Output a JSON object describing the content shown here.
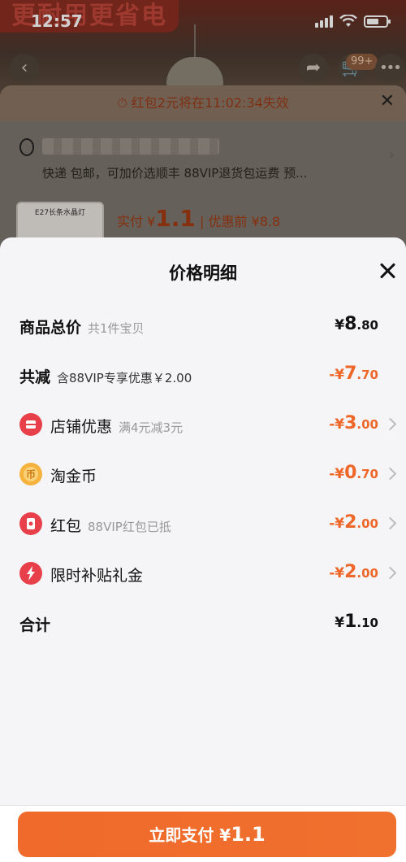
{
  "status": {
    "time": "12:57"
  },
  "background": {
    "banner": "更耐用更省电",
    "cart_badge": "99+",
    "notice": "红包2元将在11:02:34失效",
    "shipping": "快递 包邮，可加价选顺丰 88VIP退货包运费 预...",
    "thumb_label": "E27长条水晶灯",
    "pay_prefix": "实付 ¥",
    "pay_value": "1.1",
    "pay_sep": "| 优惠前 ¥8.8"
  },
  "sheet": {
    "title": "价格明细",
    "rows": [
      {
        "label": "商品总价",
        "sub": "共1件宝贝",
        "sign": "¥",
        "main": "8",
        "dec": ".80"
      },
      {
        "label": "共减",
        "sub": "含88VIP专享优惠￥2.00",
        "sign": "-¥",
        "main": "7",
        "dec": ".70"
      },
      {
        "label": "店铺优惠",
        "sub": "满4元减3元",
        "sign": "-¥",
        "main": "3",
        "dec": ".00"
      },
      {
        "label": "淘金币",
        "sub": "",
        "sign": "-¥",
        "main": "0",
        "dec": ".70"
      },
      {
        "label": "红包",
        "sub": "88VIP红包已抵",
        "sign": "-¥",
        "main": "2",
        "dec": ".00"
      },
      {
        "label": "限时补贴礼金",
        "sub": "",
        "sign": "-¥",
        "main": "2",
        "dec": ".00"
      },
      {
        "label": "合计",
        "sub": "",
        "sign": "¥",
        "main": "1",
        "dec": ".10"
      }
    ],
    "pay_button": {
      "label": "立即支付 ¥",
      "value": "1.1"
    }
  },
  "colors": {
    "accent": "#ee6628",
    "shop_icon": "#e8404a",
    "coin_icon": "#f5b23c",
    "redpack_icon": "#e8404a",
    "subsidy_icon": "#e8404a"
  }
}
